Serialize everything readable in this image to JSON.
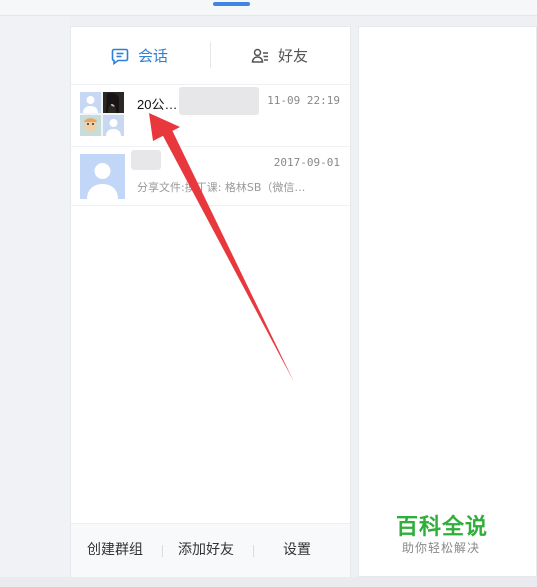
{
  "tabs": {
    "chat_label": "会话",
    "friends_label": "好友"
  },
  "conversations": [
    {
      "name": "20公…",
      "time": "11-09 22:19",
      "message": ""
    },
    {
      "name": "",
      "time": "2017-09-01",
      "message": "分享文件:摸丁课: 格林SB（微信…"
    }
  ],
  "bottom": {
    "create_group": "创建群组",
    "add_friend": "添加好友",
    "settings": "设置"
  },
  "watermark": {
    "title": "百科全说",
    "subtitle": "助你轻松解决"
  },
  "colors": {
    "accent": "#2d7fd9",
    "annotation_arrow": "#e8383d",
    "watermark_green": "#2fae3a"
  }
}
